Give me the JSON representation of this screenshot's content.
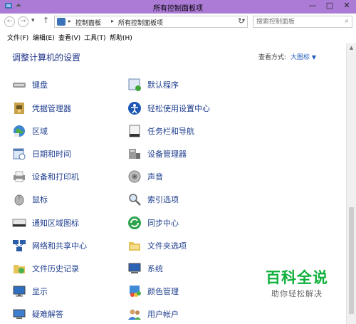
{
  "window": {
    "title": "所有控制面板项"
  },
  "nav": {
    "breadcrumb": [
      "控制面板",
      "所有控制面板项"
    ],
    "search_placeholder": "搜索控制面板"
  },
  "menu": [
    "文件(F)",
    "编辑(E)",
    "查看(V)",
    "工具(T)",
    "帮助(H)"
  ],
  "content": {
    "heading": "调整计算机的设置",
    "view_by_label": "查看方式:",
    "view_by_value": "大图标"
  },
  "items_left": [
    {
      "label": "键盘",
      "icon": "keyboard-icon"
    },
    {
      "label": "凭据管理器",
      "icon": "credential-manager-icon"
    },
    {
      "label": "区域",
      "icon": "region-globe-icon"
    },
    {
      "label": "日期和时间",
      "icon": "calendar-clock-icon"
    },
    {
      "label": "设备和打印机",
      "icon": "printer-icon"
    },
    {
      "label": "鼠标",
      "icon": "mouse-icon"
    },
    {
      "label": "通知区域图标",
      "icon": "taskbar-notification-icon"
    },
    {
      "label": "网络和共享中心",
      "icon": "network-icon"
    },
    {
      "label": "文件历史记录",
      "icon": "file-history-icon"
    },
    {
      "label": "显示",
      "icon": "display-monitor-icon"
    },
    {
      "label": "疑难解答",
      "icon": "troubleshoot-icon"
    }
  ],
  "items_right": [
    {
      "label": "默认程序",
      "icon": "default-programs-icon"
    },
    {
      "label": "轻松使用设置中心",
      "icon": "ease-of-access-icon"
    },
    {
      "label": "任务栏和导航",
      "icon": "taskbar-navigation-icon"
    },
    {
      "label": "设备管理器",
      "icon": "device-manager-icon"
    },
    {
      "label": "声音",
      "icon": "speaker-icon"
    },
    {
      "label": "索引选项",
      "icon": "indexing-magnifier-icon"
    },
    {
      "label": "同步中心",
      "icon": "sync-center-icon"
    },
    {
      "label": "文件夹选项",
      "icon": "folder-options-icon"
    },
    {
      "label": "系统",
      "icon": "system-computer-icon"
    },
    {
      "label": "颜色管理",
      "icon": "color-management-icon"
    },
    {
      "label": "用户帐户",
      "icon": "user-accounts-icon"
    }
  ],
  "watermark": {
    "title": "百科全说",
    "subtitle": "助你轻松解决"
  },
  "colors": {
    "accent": "#ab7bd6",
    "link": "#1f3f8f",
    "heading": "#1e3287",
    "watermark": "#10b03c"
  }
}
